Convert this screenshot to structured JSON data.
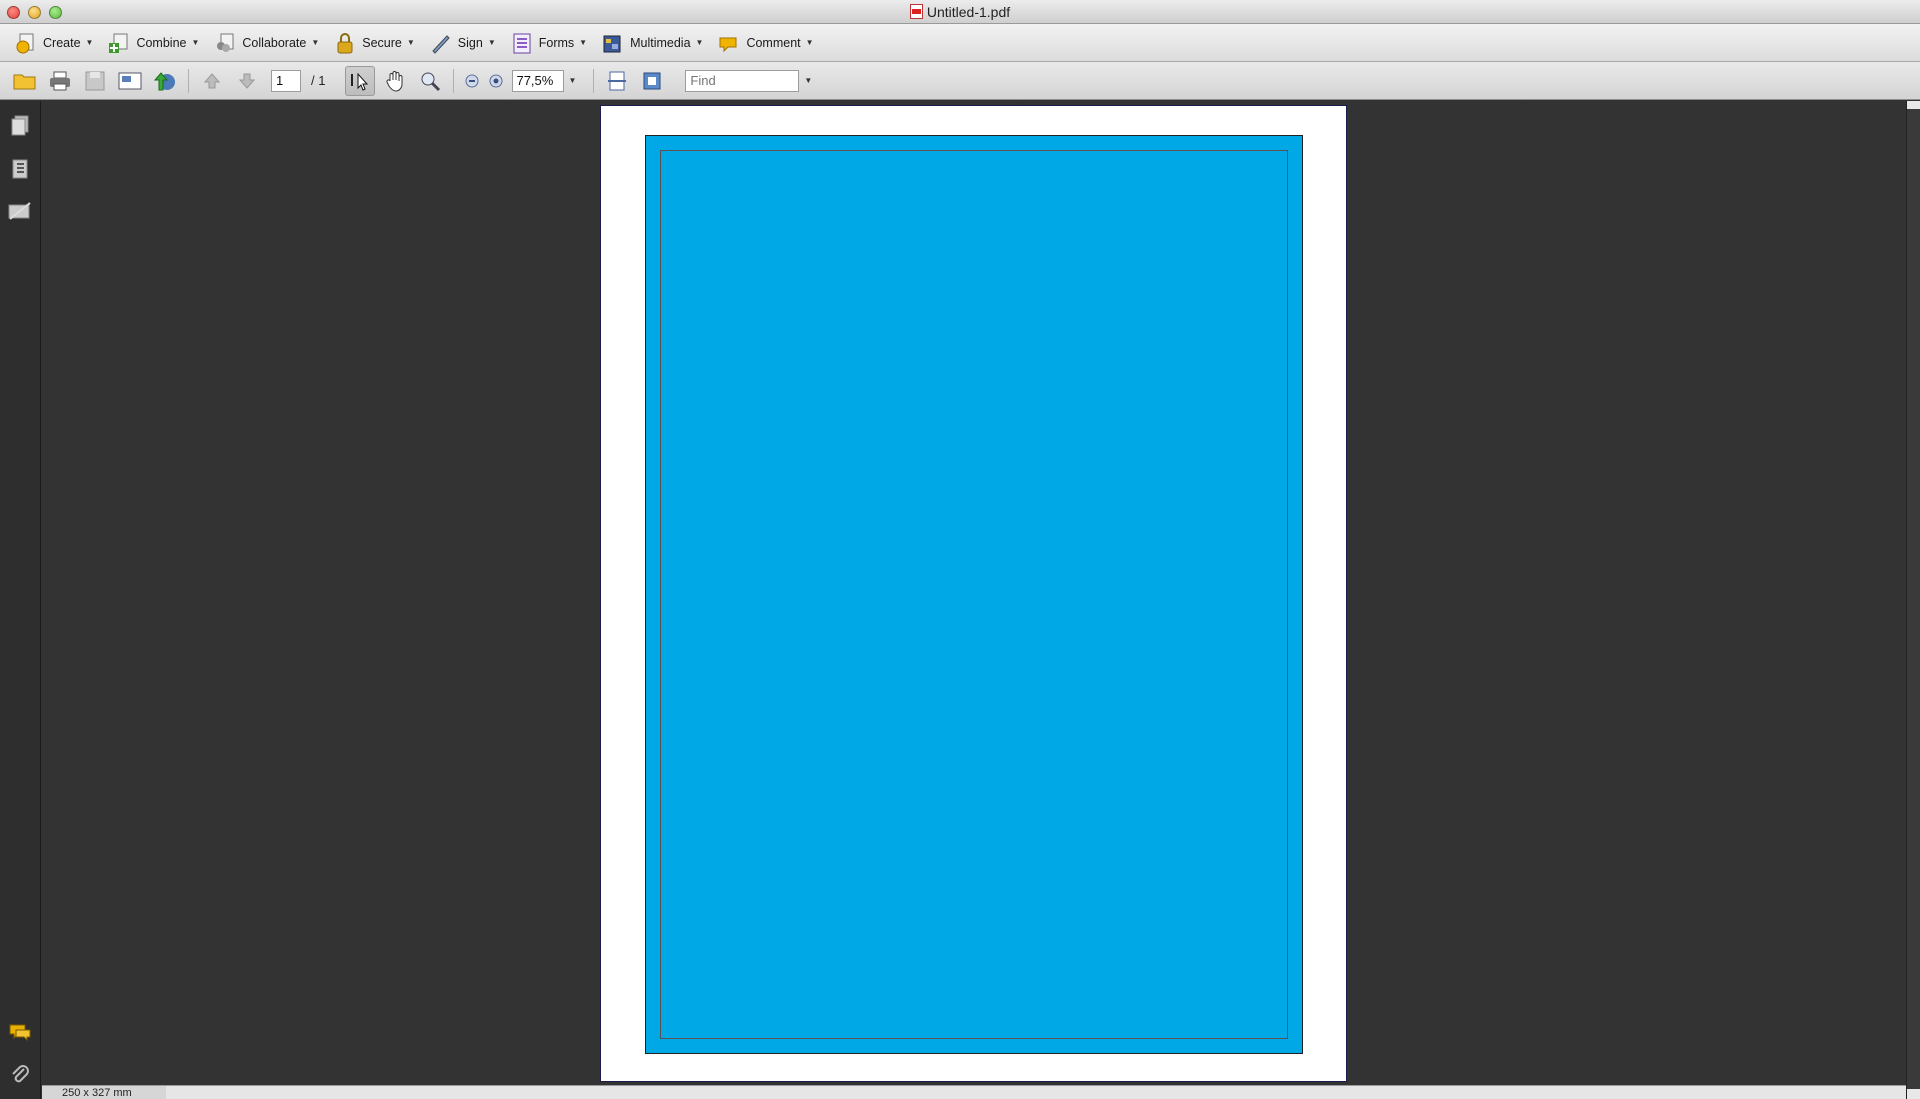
{
  "window": {
    "title": "Untitled-1.pdf"
  },
  "tasks": [
    {
      "label": "Create"
    },
    {
      "label": "Combine"
    },
    {
      "label": "Collaborate"
    },
    {
      "label": "Secure"
    },
    {
      "label": "Sign"
    },
    {
      "label": "Forms"
    },
    {
      "label": "Multimedia"
    },
    {
      "label": "Comment"
    }
  ],
  "toolbar": {
    "page_current": "1",
    "page_total": "/  1",
    "zoom": "77,5%",
    "find_placeholder": "Find"
  },
  "status": {
    "page_size": "250 x 327 mm"
  },
  "colors": {
    "page_fill": "#00a8e5",
    "workspace": "#333333"
  },
  "icons": {
    "nav": [
      "pages-icon",
      "bookmarks-icon",
      "signatures-icon",
      "comments-icon",
      "attachments-icon"
    ]
  }
}
